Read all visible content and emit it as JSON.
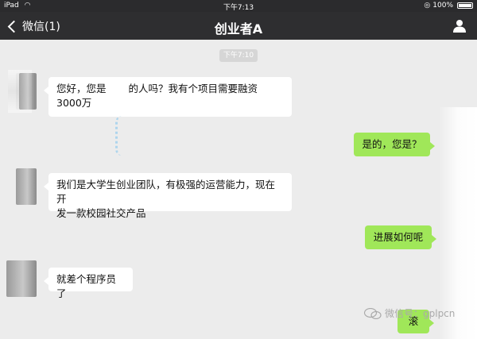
{
  "status_bar": {
    "device": "iPad",
    "time": "下午7:13",
    "battery": "100%"
  },
  "nav": {
    "back_label": "微信(1)",
    "title": "创业者A"
  },
  "chat": {
    "timestamp": "下午7:10",
    "messages": [
      {
        "from": "other",
        "text_line1": "您好，您是",
        "text_line1b": "的人吗？我有个项目需要融资",
        "text_line2": "3000万"
      },
      {
        "from": "me",
        "text": "是的，您是？"
      },
      {
        "from": "other",
        "text_line1": "我们是大学生创业团队，有极强的运营能力，现在开",
        "text_line2": "发一款校园社交产品"
      },
      {
        "from": "me",
        "text": "进展如何呢"
      },
      {
        "from": "other",
        "text": "就差个程序员了"
      },
      {
        "from": "me",
        "text": "滚"
      }
    ]
  },
  "watermark": "微信号：gplpcn",
  "colors": {
    "nav_bg": "#2e2e30",
    "chat_bg": "#ececec",
    "out_bubble": "#a0e759",
    "in_bubble": "#ffffff"
  }
}
